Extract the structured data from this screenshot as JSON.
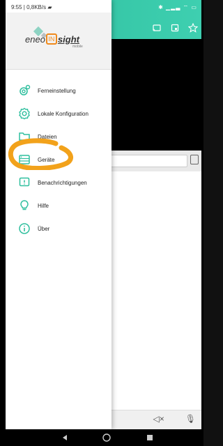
{
  "status_bar": {
    "time_speed": "9:55 | 0,8KB/s",
    "right_icons": "bluetooth, signal, wifi, battery"
  },
  "logo": {
    "brand_left": "eneo",
    "brand_in": "IN",
    "brand_right": "sight",
    "subtitle": "mobile"
  },
  "menu": {
    "items": [
      {
        "label": "Ferneinstellung",
        "icon": "remote-settings-icon"
      },
      {
        "label": "Lokale Konfiguration",
        "icon": "local-config-icon"
      },
      {
        "label": "Dateien",
        "icon": "folder-icon"
      },
      {
        "label": "Geräte",
        "icon": "devices-icon"
      },
      {
        "label": "Benachrichtigungen",
        "icon": "notification-icon"
      },
      {
        "label": "Hilfe",
        "icon": "lightbulb-icon"
      },
      {
        "label": "Über",
        "icon": "info-icon"
      }
    ]
  },
  "colors": {
    "accent": "#2fbf9e",
    "highlight": "#f2a21b",
    "icon": "#2fbf9e"
  },
  "navbar": {
    "icons": [
      "back-icon",
      "home-icon",
      "recents-icon"
    ]
  }
}
